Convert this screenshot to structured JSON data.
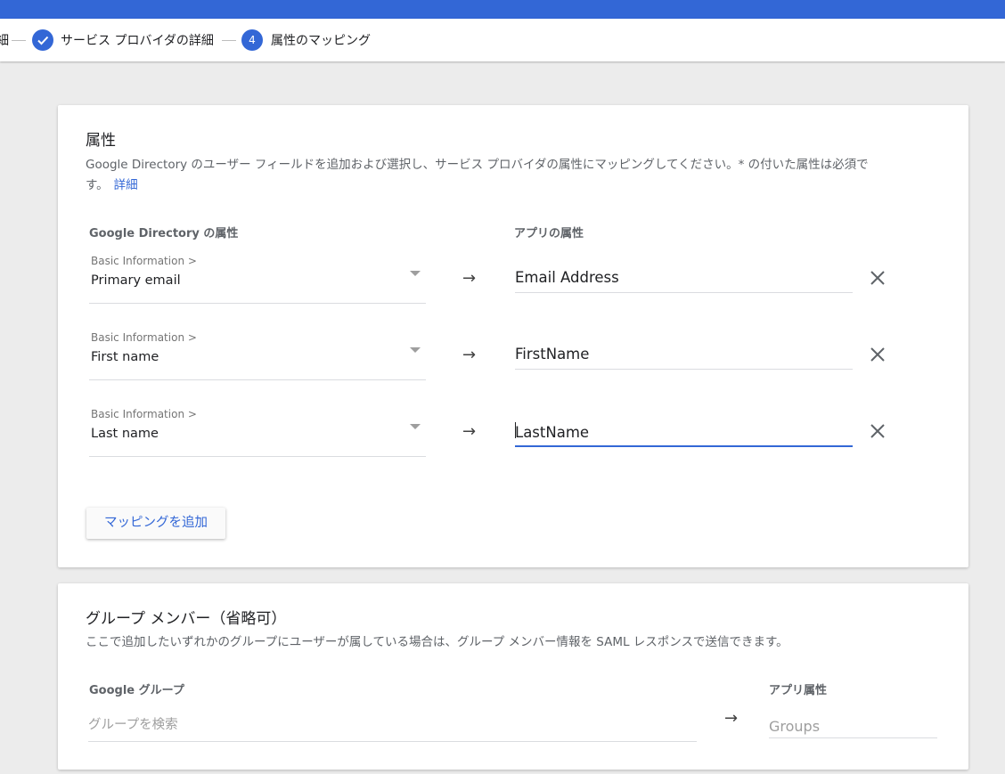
{
  "stepper": {
    "prev_fragment": "細",
    "step3_label": "サービス プロバイダの詳細",
    "step4_number": "4",
    "step4_label": "属性のマッピング"
  },
  "attributes": {
    "title": "属性",
    "desc_line1": "Google Directory のユーザー フィールドを追加および選択し、サービス プロバイダの属性にマッピングしてください。* の付いた属性は必須で",
    "desc_line2": "す。",
    "details_link": "詳細",
    "col_directory": "Google Directory の属性",
    "col_app": "アプリの属性",
    "mappings": [
      {
        "category": "Basic Information >",
        "field": "Primary email",
        "app_attr": "Email Address"
      },
      {
        "category": "Basic Information >",
        "field": "First name",
        "app_attr": "FirstName"
      },
      {
        "category": "Basic Information >",
        "field": "Last name",
        "app_attr": "LastName"
      }
    ],
    "add_mapping": "マッピングを追加"
  },
  "groups": {
    "title": "グループ メンバー（省略可）",
    "desc": "ここで追加したいずれかのグループにユーザーが属している場合は、グループ メンバー情報を SAML レスポンスで送信できます。",
    "col_google_group": "Google グループ",
    "col_app_attr": "アプリ属性",
    "search_placeholder": "グループを検索",
    "groups_placeholder": "Groups"
  },
  "arrow_glyph": "→",
  "colors": {
    "accent": "#3367d6",
    "background": "#ececec"
  }
}
